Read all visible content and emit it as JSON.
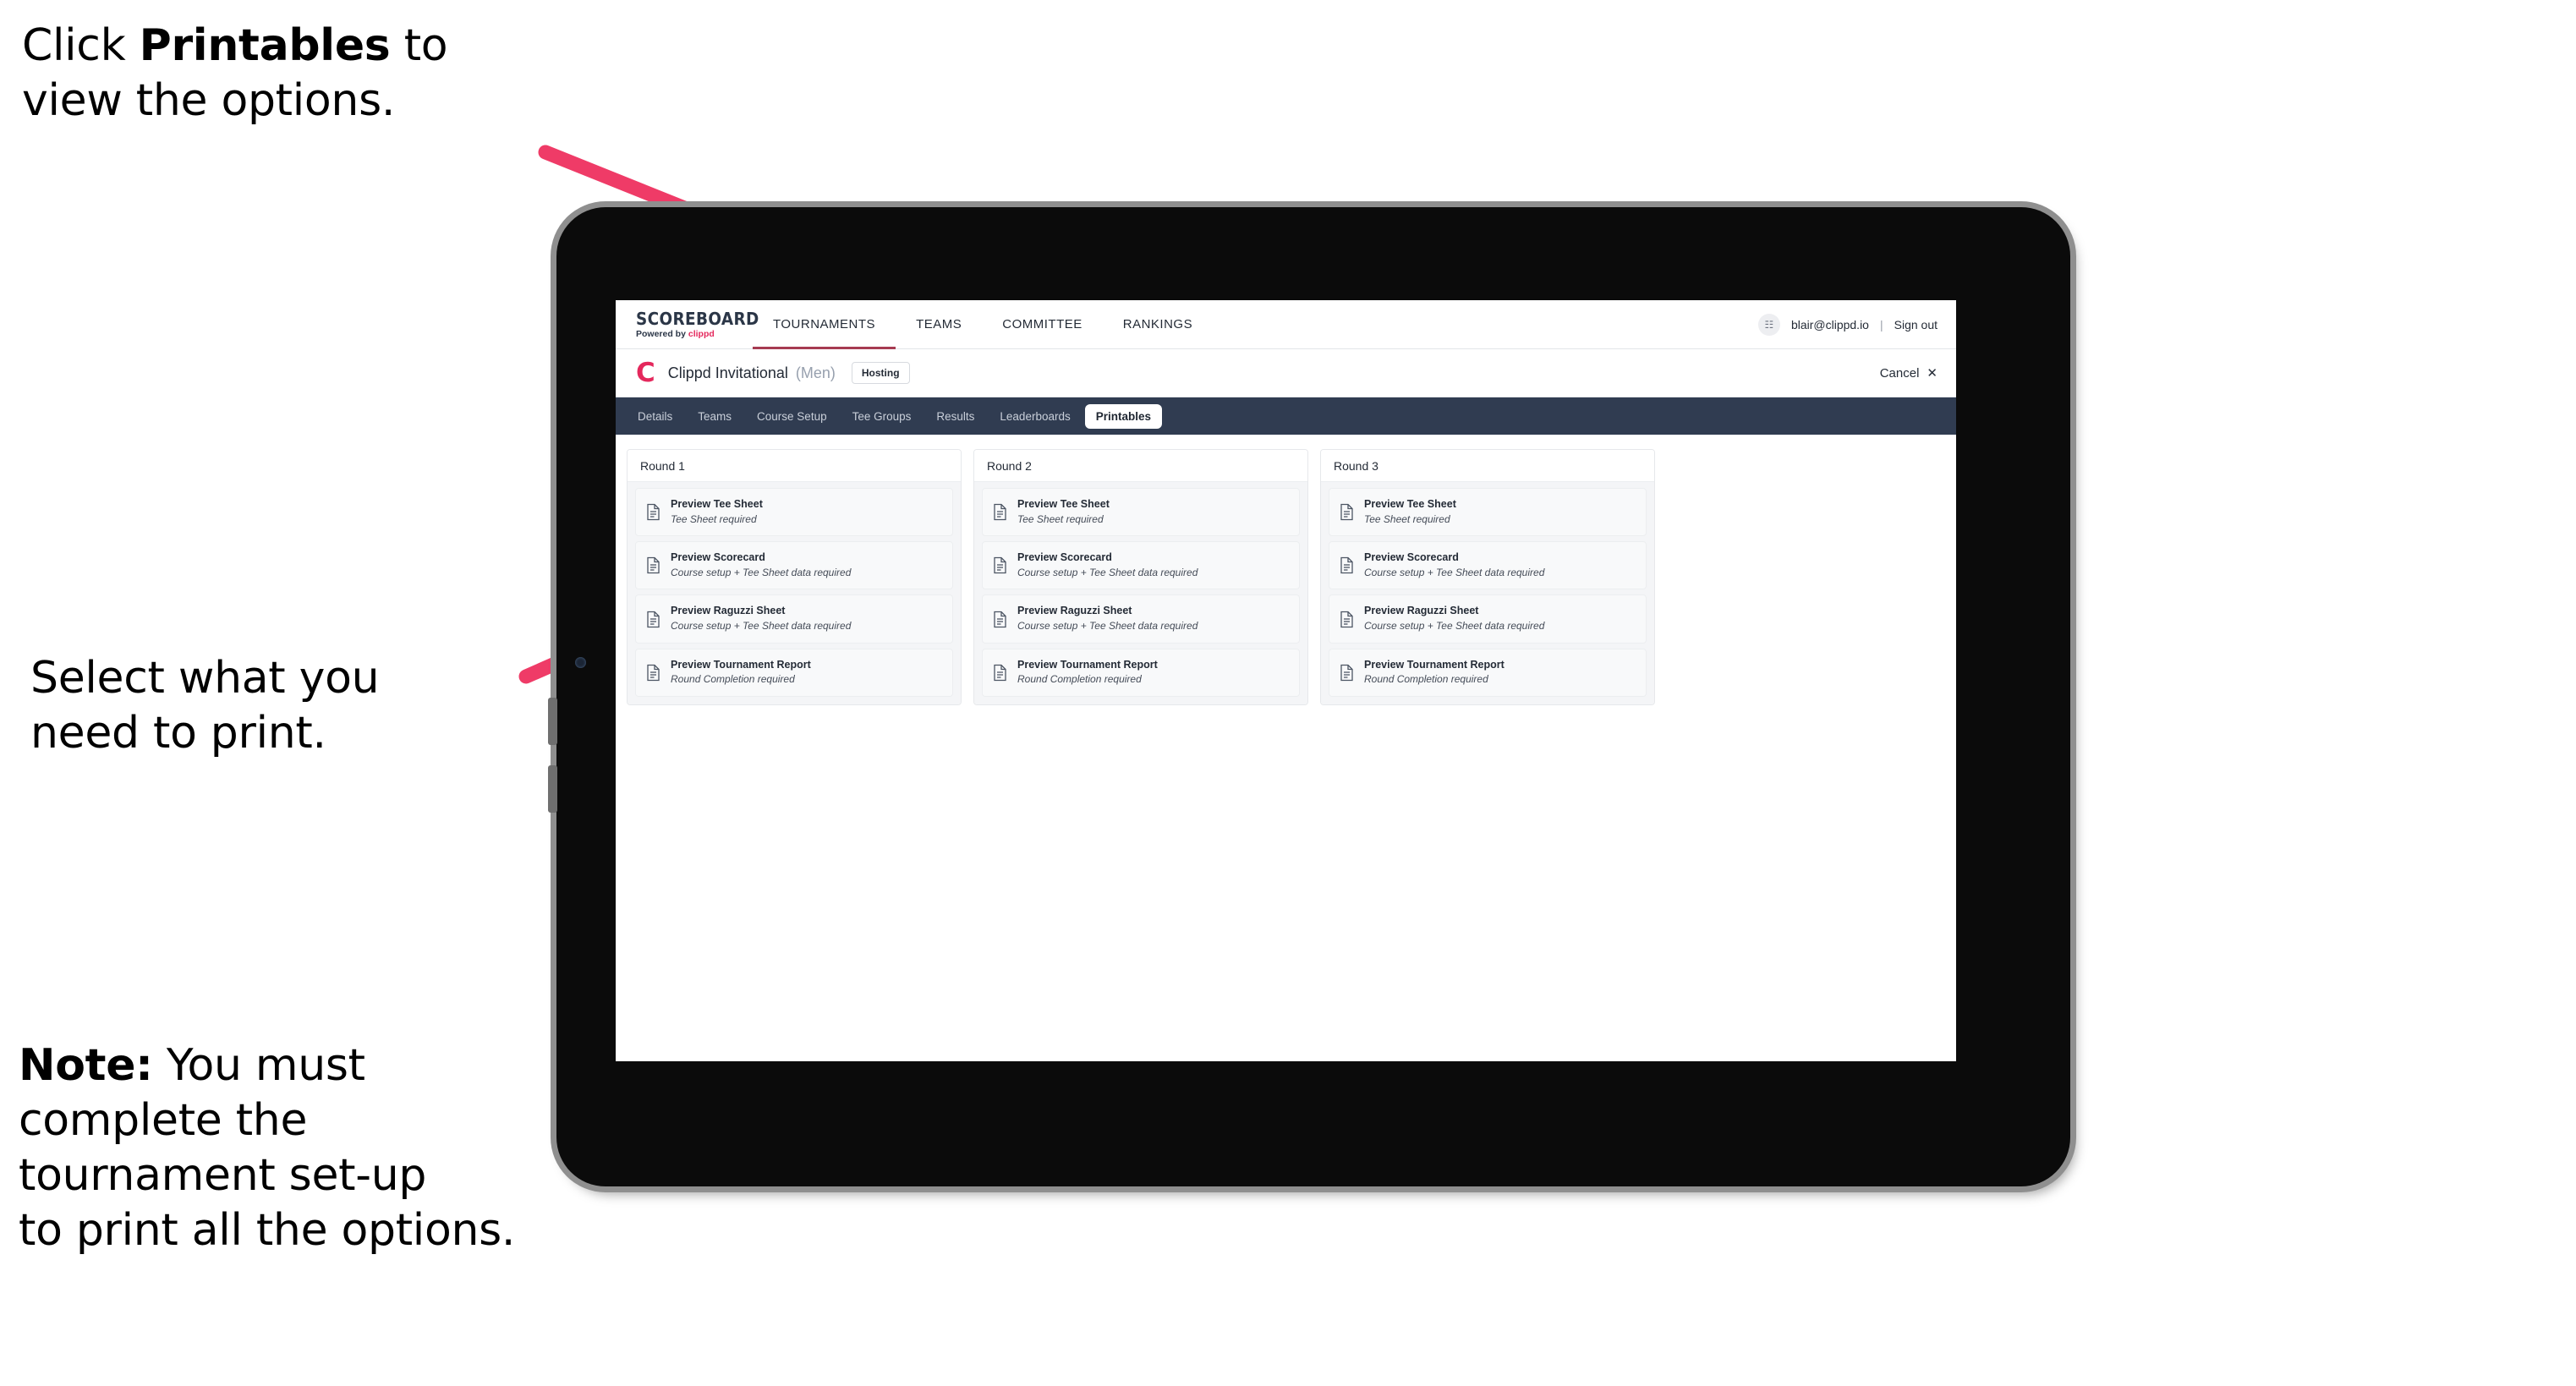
{
  "annotations": {
    "click_printables": "Click Printables to\nview the options.",
    "click_printables_bold": "Printables",
    "click_printables_pre": "Click ",
    "click_printables_post": " to\nview the options.",
    "select_what": "Select what you\n need to print.",
    "note_bold": "Note:",
    "note_rest": " You must\ncomplete the\ntournament set-up\nto print all the options.",
    "arrow_color": "#ef3b67"
  },
  "browser": {
    "brand": {
      "title": "SCOREBOARD",
      "subtitle_prefix": "Powered by ",
      "subtitle_brand": "clippd"
    },
    "main_nav": [
      {
        "label": "TOURNAMENTS",
        "active": true
      },
      {
        "label": "TEAMS",
        "active": false
      },
      {
        "label": "COMMITTEE",
        "active": false
      },
      {
        "label": "RANKINGS",
        "active": false
      }
    ],
    "user": {
      "avatar_glyph": "☷",
      "email": "blair@clippd.io",
      "divider": "|",
      "sign_out": "Sign out"
    },
    "tournament": {
      "mark": "C",
      "name": "Clippd Invitational",
      "gender": "(Men)",
      "status_badge": "Hosting",
      "cancel_label": "Cancel",
      "cancel_icon": "✕"
    },
    "sub_nav": [
      {
        "label": "Details",
        "active": false
      },
      {
        "label": "Teams",
        "active": false
      },
      {
        "label": "Course Setup",
        "active": false
      },
      {
        "label": "Tee Groups",
        "active": false
      },
      {
        "label": "Results",
        "active": false
      },
      {
        "label": "Leaderboards",
        "active": false
      },
      {
        "label": "Printables",
        "active": true
      }
    ],
    "rounds": [
      {
        "title": "Round 1",
        "items": [
          {
            "title": "Preview Tee Sheet",
            "subtitle": "Tee Sheet required"
          },
          {
            "title": "Preview Scorecard",
            "subtitle": "Course setup + Tee Sheet data required"
          },
          {
            "title": "Preview Raguzzi Sheet",
            "subtitle": "Course setup + Tee Sheet data required"
          },
          {
            "title": "Preview Tournament Report",
            "subtitle": "Round Completion required"
          }
        ]
      },
      {
        "title": "Round 2",
        "items": [
          {
            "title": "Preview Tee Sheet",
            "subtitle": "Tee Sheet required"
          },
          {
            "title": "Preview Scorecard",
            "subtitle": "Course setup + Tee Sheet data required"
          },
          {
            "title": "Preview Raguzzi Sheet",
            "subtitle": "Course setup + Tee Sheet data required"
          },
          {
            "title": "Preview Tournament Report",
            "subtitle": "Round Completion required"
          }
        ]
      },
      {
        "title": "Round 3",
        "items": [
          {
            "title": "Preview Tee Sheet",
            "subtitle": "Tee Sheet required"
          },
          {
            "title": "Preview Scorecard",
            "subtitle": "Course setup + Tee Sheet data required"
          },
          {
            "title": "Preview Raguzzi Sheet",
            "subtitle": "Course setup + Tee Sheet data required"
          },
          {
            "title": "Preview Tournament Report",
            "subtitle": "Round Completion required"
          }
        ]
      }
    ]
  },
  "colors": {
    "accent_pink": "#e4285c",
    "subnav_bg": "#303c51",
    "nav_underline": "#a63b52",
    "arrow": "#ef3b67"
  }
}
